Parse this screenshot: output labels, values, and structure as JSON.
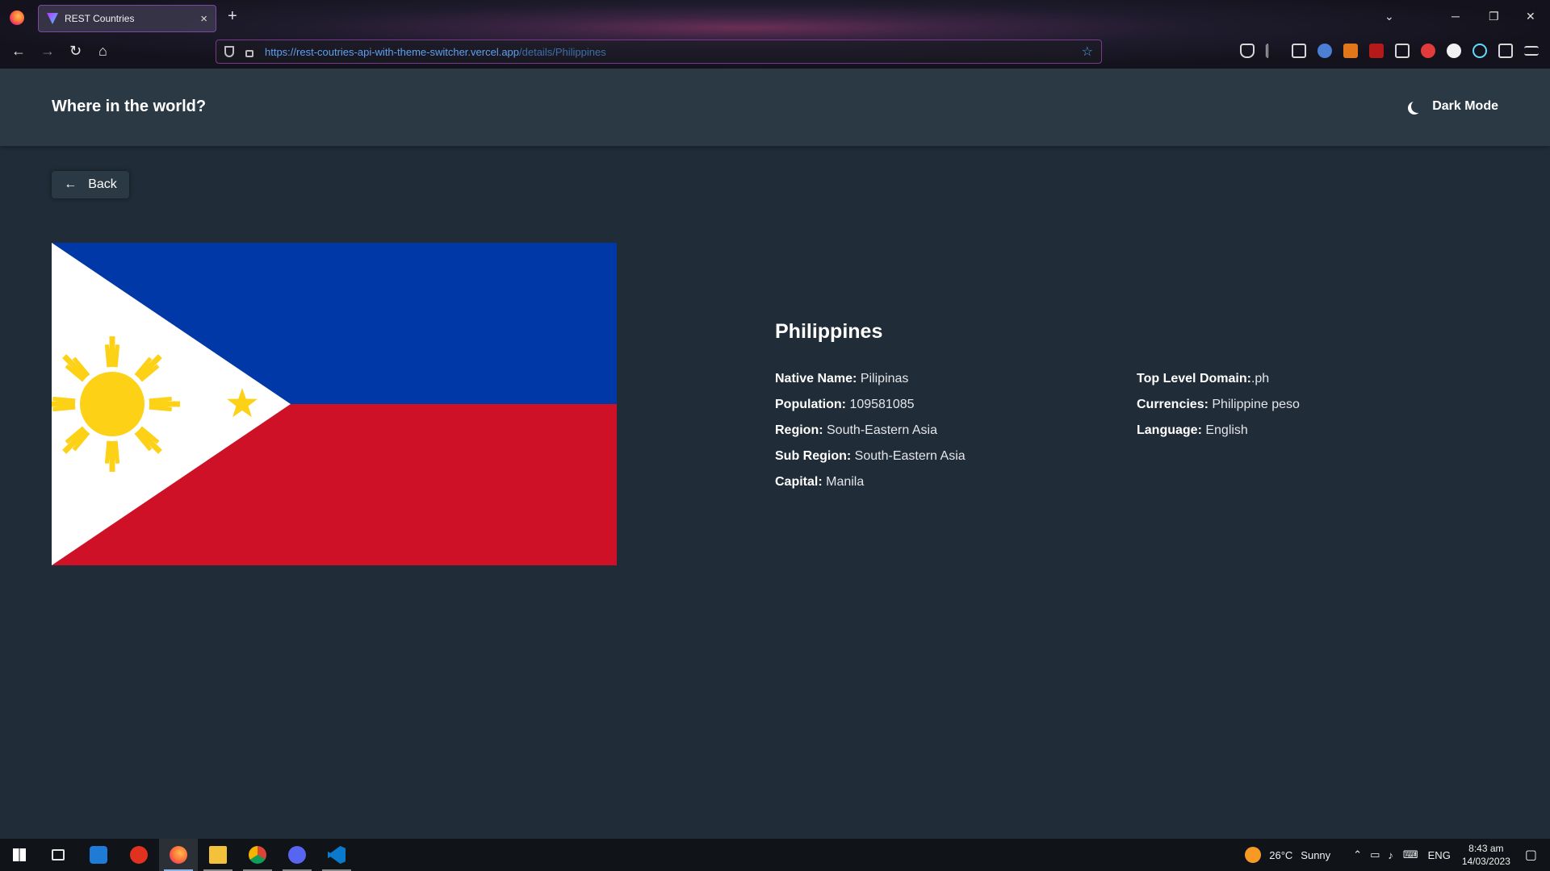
{
  "browser": {
    "tab_title": "REST Countries",
    "tab_close": "×",
    "new_tab": "+",
    "url_host": "https://rest-coutries-api-with-theme-switcher.vercel.app",
    "url_path": "/details/Philippines"
  },
  "header": {
    "title": "Where in the world?",
    "theme_label": "Dark Mode"
  },
  "back_button": {
    "arrow": "←",
    "label": "Back"
  },
  "country": {
    "name": "Philippines",
    "flag_colors": {
      "blue": "#0038a8",
      "red": "#ce1126",
      "white": "#ffffff",
      "yellow": "#fcd116"
    },
    "left_details": [
      {
        "label": "Native Name:",
        "value": "Pilipinas"
      },
      {
        "label": "Population:",
        "value": "109581085"
      },
      {
        "label": "Region:",
        "value": "South-Eastern Asia"
      },
      {
        "label": "Sub Region:",
        "value": "South-Eastern Asia"
      },
      {
        "label": "Capital:",
        "value": "Manila"
      }
    ],
    "right_details": [
      {
        "label": "Top Level Domain:",
        "value": ".ph"
      },
      {
        "label": "Currencies:",
        "value": "Philippine peso"
      },
      {
        "label": "Language:",
        "value": "English"
      }
    ]
  },
  "colors": {
    "background": "#202c37",
    "elements": "#2b3945",
    "text": "#ffffff"
  },
  "taskbar": {
    "weather_temp": "26°C",
    "weather_desc": "Sunny",
    "language": "ENG",
    "time": "8:43 am",
    "date": "14/03/2023"
  }
}
